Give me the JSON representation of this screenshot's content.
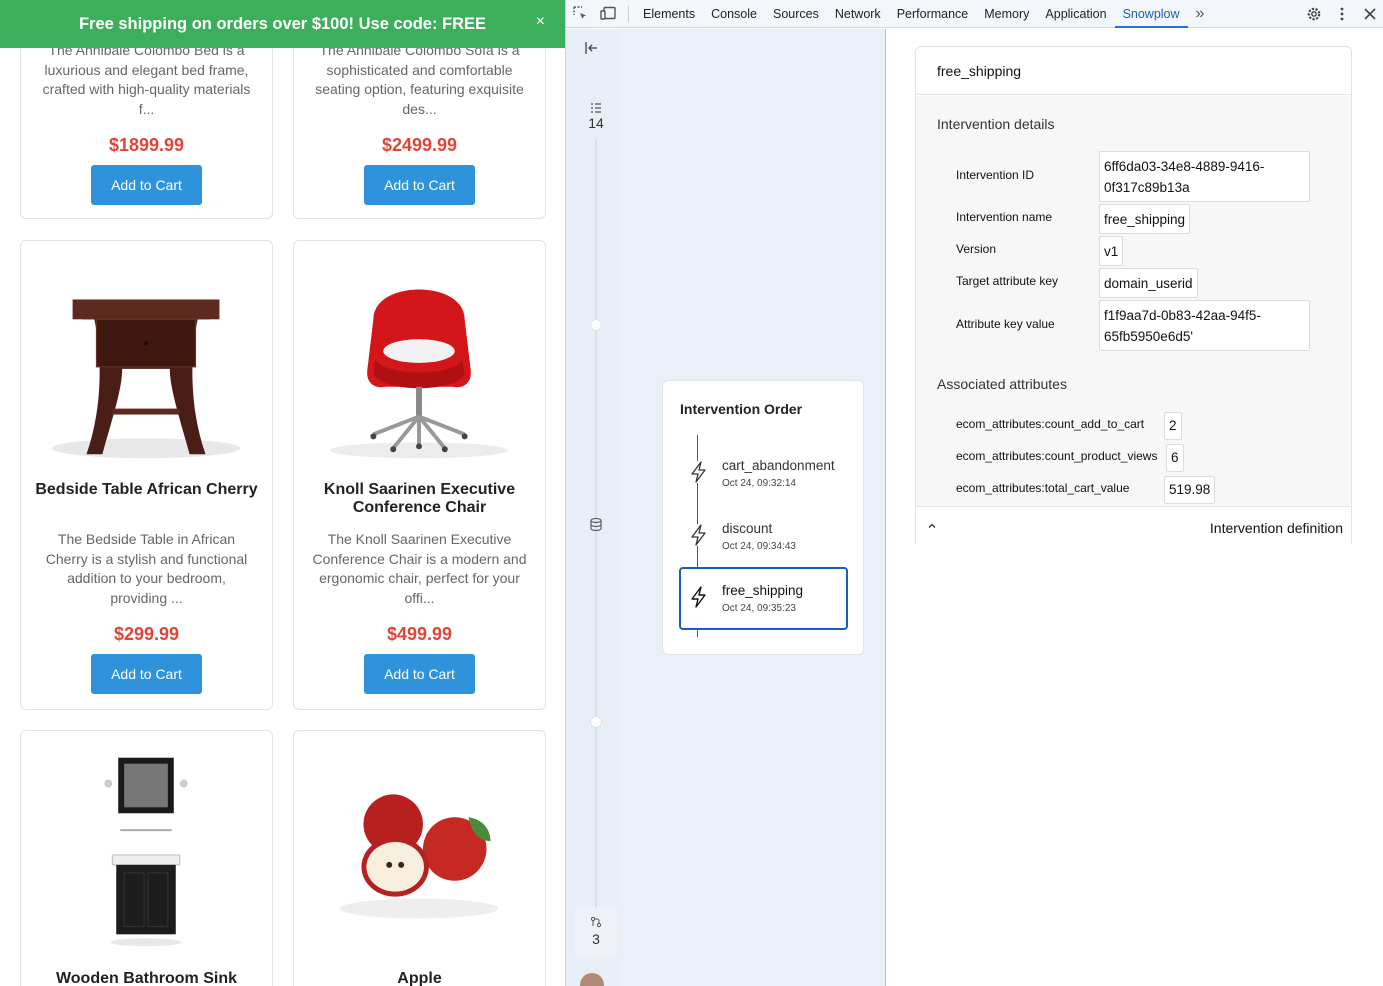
{
  "promo": {
    "text": "Free shipping on orders over $100! Use code: FREE",
    "close": "×"
  },
  "products": [
    {
      "title": "",
      "desc": "The Annibale Colombo Bed is a luxurious and elegant bed frame, crafted with high-quality materials f...",
      "price": "$1899.99",
      "button": "Add to Cart"
    },
    {
      "title": "",
      "desc": "The Annibale Colombo Sofa is a sophisticated and comfortable seating option, featuring exquisite des...",
      "price": "$2499.99",
      "button": "Add to Cart"
    },
    {
      "title": "Bedside Table African Cherry",
      "desc": "The Bedside Table in African Cherry is a stylish and functional addition to your bedroom, providing ...",
      "price": "$299.99",
      "button": "Add to Cart"
    },
    {
      "title": "Knoll Saarinen Executive Conference Chair",
      "desc": "The Knoll Saarinen Executive Conference Chair is a modern and ergonomic chair, perfect for your offi...",
      "price": "$499.99",
      "button": "Add to Cart"
    },
    {
      "title": "Wooden Bathroom Sink",
      "desc": "",
      "price": "",
      "button": ""
    },
    {
      "title": "Apple",
      "desc": "",
      "price": "",
      "button": ""
    }
  ],
  "devtools": {
    "tabs": [
      "Elements",
      "Console",
      "Sources",
      "Network",
      "Performance",
      "Memory",
      "Application",
      "Snowplow"
    ],
    "active_tab": "Snowplow",
    "more": "»",
    "rail": {
      "events_count": "14",
      "branches_count": "3"
    }
  },
  "intervention_order": {
    "title": "Intervention Order",
    "items": [
      {
        "name": "cart_abandonment",
        "time": "Oct 24, 09:32:14"
      },
      {
        "name": "discount",
        "time": "Oct 24, 09:34:43"
      },
      {
        "name": "free_shipping",
        "time": "Oct 24, 09:35:23"
      }
    ]
  },
  "details": {
    "header": "free_shipping",
    "section_title": "Intervention details",
    "fields": [
      {
        "label": "Intervention ID",
        "value": "6ff6da03-34e8-4889-9416-0f317c89b13a"
      },
      {
        "label": "Intervention name",
        "value": "free_shipping"
      },
      {
        "label": "Version",
        "value": "v1"
      },
      {
        "label": "Target attribute key",
        "value": "domain_userid"
      },
      {
        "label": "Attribute key value",
        "value": "f1f9aa7d-0b83-42aa-94f5-65fb5950e6d5'"
      }
    ],
    "assoc_title": "Associated attributes",
    "attributes": [
      {
        "label": "ecom_attributes:count_add_to_cart",
        "value": "2"
      },
      {
        "label": "ecom_attributes:count_product_views",
        "value": "6"
      },
      {
        "label": "ecom_attributes:total_cart_value",
        "value": "519.98"
      }
    ],
    "definition_label": "Intervention definition"
  },
  "colors": {
    "promo": "#3cae5c",
    "price": "#e0453a",
    "button": "#2e93db",
    "selected": "#1a5fb4"
  }
}
